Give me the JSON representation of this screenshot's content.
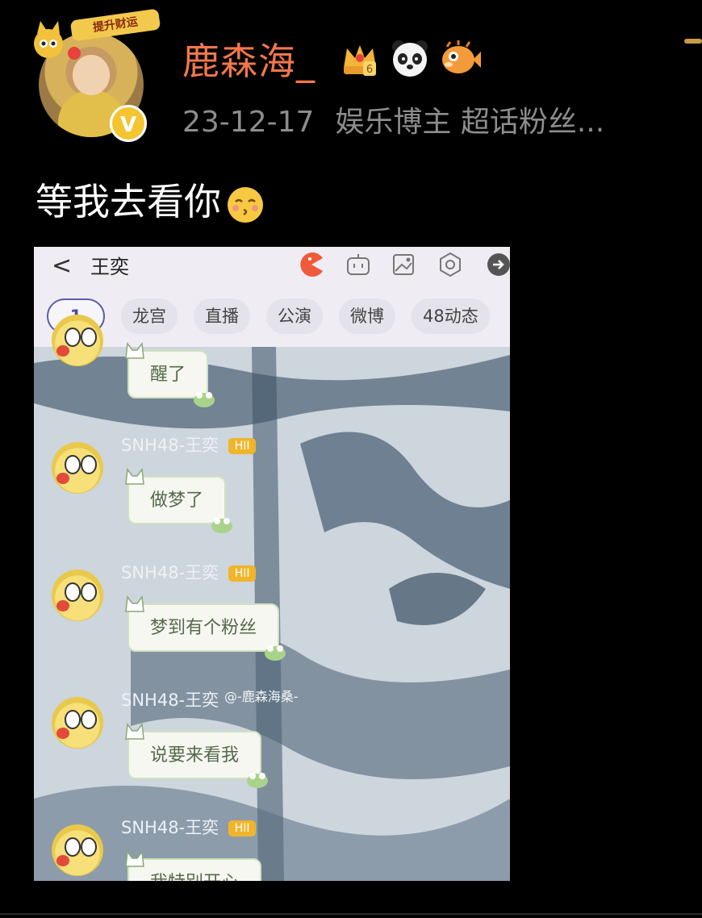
{
  "post": {
    "username": "鹿森海_",
    "avatar_badge": "提升财运",
    "date": "23-12-17",
    "tags": "娱乐博主 超话粉丝...",
    "text": "等我去看你",
    "icons": [
      "crown-level-6-icon",
      "panda-icon",
      "pufferfish-icon",
      "verified-v-icon",
      "kiss-emoji-icon"
    ]
  },
  "screenshot": {
    "back": "<",
    "title": "王奕",
    "tabs": [
      {
        "label": "1",
        "active": true
      },
      {
        "label": "龙宫"
      },
      {
        "label": "直播"
      },
      {
        "label": "公演"
      },
      {
        "label": "微博"
      },
      {
        "label": "48动态"
      }
    ],
    "messages": [
      {
        "sender": "",
        "level": "",
        "text": "醒了"
      },
      {
        "sender": "SNH48-王奕",
        "level": "HII",
        "text": "做梦了"
      },
      {
        "sender": "SNH48-王奕",
        "level": "HII",
        "text": "梦到有个粉丝"
      },
      {
        "sender": "SNH48-王奕",
        "level": "",
        "text": "说要来看我"
      },
      {
        "sender": "SNH48-王奕",
        "level": "HII",
        "text": "我特别开心"
      }
    ],
    "watermark": "@-鹿森海桑-"
  },
  "colors": {
    "background": "#000000",
    "username": "#f2774a",
    "meta": "#8d8d8d",
    "level_badge": "#f0b52b",
    "active_tab_border": "#5b5ea5"
  }
}
